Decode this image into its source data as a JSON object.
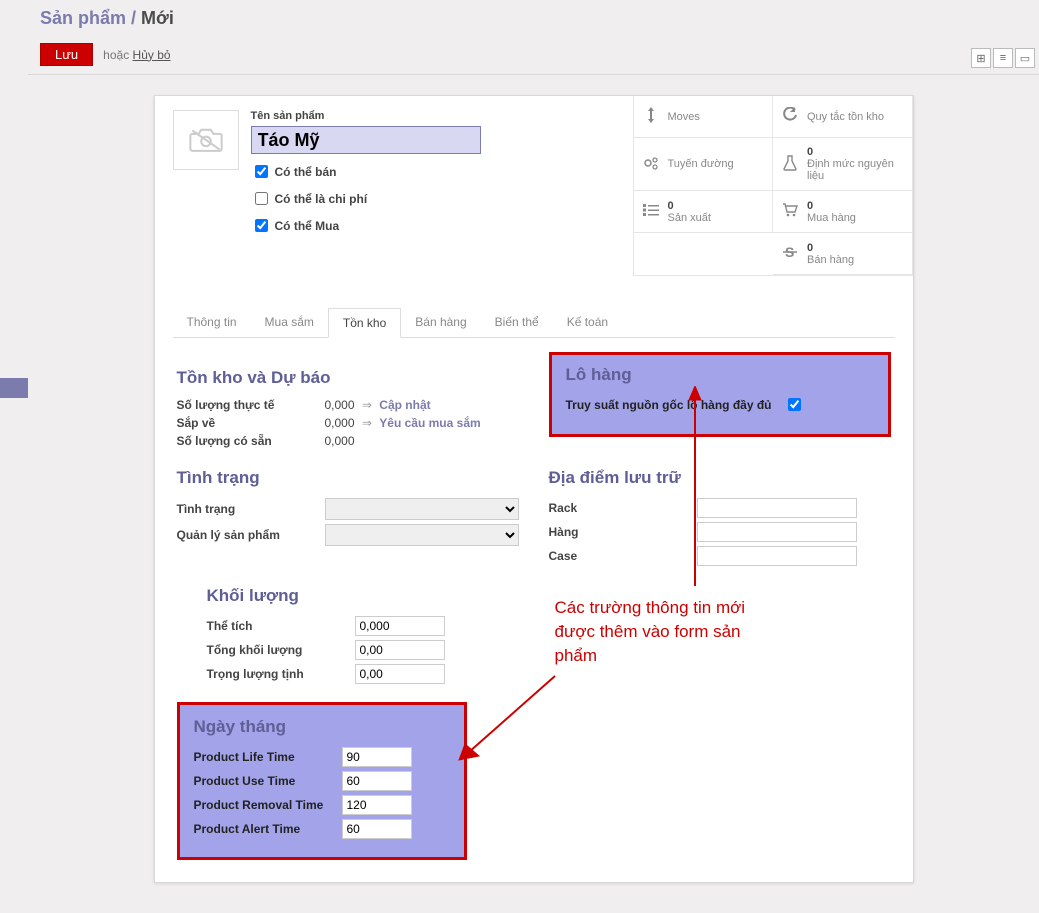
{
  "breadcrumb": {
    "root": "Sản phẩm",
    "sep": " / ",
    "current": "Mới"
  },
  "actions": {
    "save": "Lưu",
    "or": "hoặc",
    "discard": "Hủy bỏ"
  },
  "view_switch": {
    "kanban_glyph": "⊞",
    "list_glyph": "≡",
    "form_glyph": "▭"
  },
  "header": {
    "name_label": "Tên sản phẩm",
    "name_value": "Táo Mỹ",
    "can_sell": "Có thể bán",
    "can_expense": "Có thể là chi phí",
    "can_buy": "Có thể Mua"
  },
  "stat_buttons": {
    "moves": "Moves",
    "reorder": "Quy tắc tồn kho",
    "routes": "Tuyến đường",
    "bom_num": "0",
    "bom_lbl": "Định mức nguyên liệu",
    "mo_num": "0",
    "mo_lbl": "Sản xuất",
    "po_num": "0",
    "po_lbl": "Mua hàng",
    "so_num": "0",
    "so_lbl": "Bán hàng"
  },
  "tabs": [
    "Thông tin",
    "Mua sắm",
    "Tồn kho",
    "Bán hàng",
    "Biến thể",
    "Kế toán"
  ],
  "inventory": {
    "title": "Tồn kho và Dự báo",
    "qty_onhand_lbl": "Số lượng thực tế",
    "qty_onhand_val": "0,000",
    "update": "Cập nhật",
    "incoming_lbl": "Sắp về",
    "incoming_val": "0,000",
    "request": "Yêu cầu mua sắm",
    "available_lbl": "Số lượng có sẵn",
    "available_val": "0,000"
  },
  "lot": {
    "title": "Lô hàng",
    "full_trace": "Truy suất nguồn gốc lô hàng đầy đủ"
  },
  "status": {
    "title": "Tình trạng",
    "status_lbl": "Tình trạng",
    "pm_lbl": "Quản lý sản phẩm"
  },
  "storage": {
    "title": "Địa điểm lưu trữ",
    "rack": "Rack",
    "row": "Hàng",
    "case": "Case"
  },
  "weight_sec": {
    "title": "Khối lượng",
    "volume_lbl": "Thể tích",
    "volume_val": "0,000",
    "gross_lbl": "Tổng khối lượng",
    "gross_val": "0,00",
    "net_lbl": "Trọng lượng tịnh",
    "net_val": "0,00"
  },
  "dates": {
    "title": "Ngày tháng",
    "life_lbl": "Product Life Time",
    "life_val": "90",
    "use_lbl": "Product Use Time",
    "use_val": "60",
    "removal_lbl": "Product Removal Time",
    "removal_val": "120",
    "alert_lbl": "Product Alert Time",
    "alert_val": "60"
  },
  "annotation": "Các trường thông tin mới\nđược thêm vào form sản\nphẩm"
}
